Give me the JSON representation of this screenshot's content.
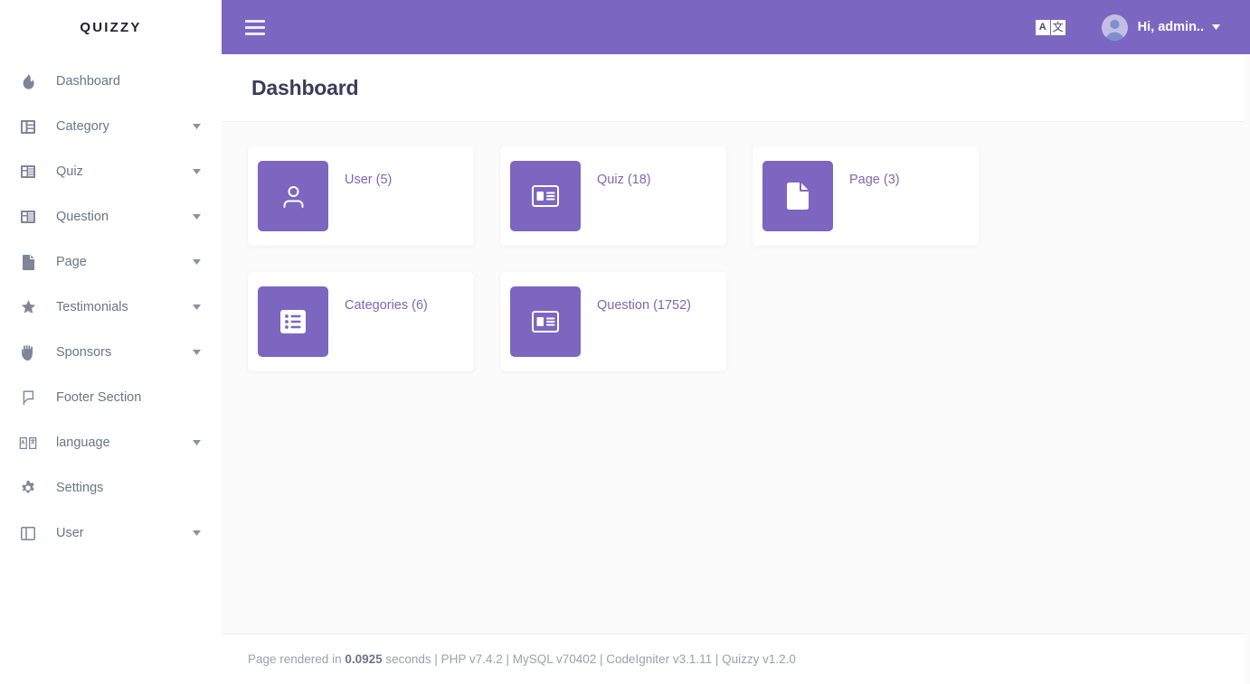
{
  "brand": {
    "name": "QUIZZY"
  },
  "colors": {
    "accent_purple": "#7b66c2",
    "icon_tile_purple": "#7c66c0",
    "card_link_text": "#7a6ab3",
    "page_title": "#3b3b5c",
    "sidebar_text": "#6d7585",
    "content_bg": "#fbfbfc"
  },
  "sidebar": {
    "items": [
      {
        "label": "Dashboard",
        "icon": "flame-icon",
        "has_caret": false
      },
      {
        "label": "Category",
        "icon": "table-columns-icon",
        "has_caret": true
      },
      {
        "label": "Quiz",
        "icon": "table-list-icon",
        "has_caret": true
      },
      {
        "label": "Question",
        "icon": "table-list-icon",
        "has_caret": true
      },
      {
        "label": "Page",
        "icon": "file-icon",
        "has_caret": true
      },
      {
        "label": "Testimonials",
        "icon": "star-half-icon",
        "has_caret": true
      },
      {
        "label": "Sponsors",
        "icon": "hand-icon",
        "has_caret": true
      },
      {
        "label": "Footer Section",
        "icon": "flag-icon",
        "has_caret": false
      },
      {
        "label": "language",
        "icon": "translate-icon",
        "has_caret": true
      },
      {
        "label": "Settings",
        "icon": "gear-icon",
        "has_caret": false
      },
      {
        "label": "User",
        "icon": "columns-icon",
        "has_caret": true
      }
    ]
  },
  "topbar": {
    "menu_toggle_icon": "hamburger-icon",
    "translate": {
      "icon": "translate-icon",
      "latin_glyph": "A",
      "cjk_glyph": "文"
    },
    "user": {
      "greeting": "Hi, admin..",
      "avatar_icon": "user-avatar-icon",
      "caret_icon": "chevron-down-icon"
    }
  },
  "page": {
    "title": "Dashboard"
  },
  "stat_cards": [
    {
      "label": "User (5)",
      "icon": "user-icon",
      "count": 5,
      "entity": "User"
    },
    {
      "label": "Quiz (18)",
      "icon": "table-list-icon",
      "count": 18,
      "entity": "Quiz"
    },
    {
      "label": "Page (3)",
      "icon": "file-icon",
      "count": 3,
      "entity": "Page"
    },
    {
      "label": "Categories (6)",
      "icon": "list-ul-icon",
      "count": 6,
      "entity": "Categories"
    },
    {
      "label": "Question (1752)",
      "icon": "table-list-icon",
      "count": 1752,
      "entity": "Question"
    }
  ],
  "footer": {
    "prefix": "Page rendered in ",
    "render_time": "0.0925",
    "suffix": " seconds | PHP v7.4.2 | MySQL v70402 | CodeIgniter v3.1.11 | Quizzy v1.2.0"
  }
}
